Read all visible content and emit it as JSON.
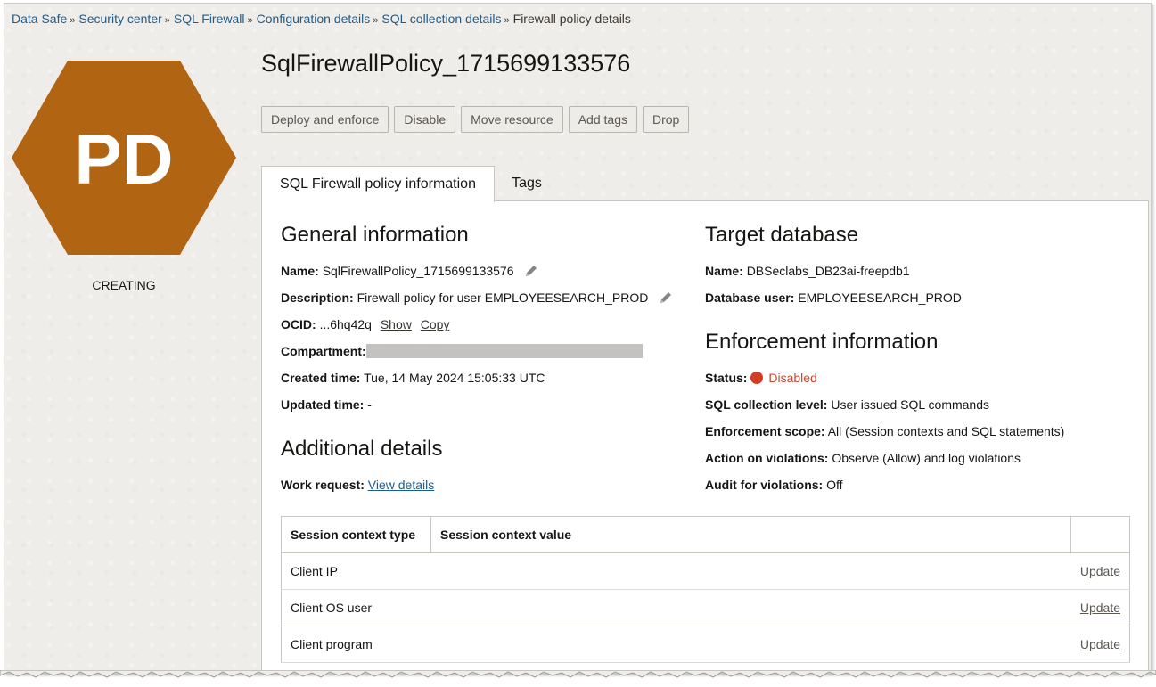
{
  "breadcrumb": {
    "items": [
      "Data Safe",
      "Security center",
      "SQL Firewall",
      "Configuration details",
      "SQL collection details"
    ],
    "separator": "»",
    "current": "Firewall policy details"
  },
  "badge": {
    "initials": "PD",
    "color": "#b16412",
    "status": "CREATING"
  },
  "title": "SqlFirewallPolicy_1715699133576",
  "actions": {
    "deploy": "Deploy and enforce",
    "disable": "Disable",
    "move": "Move resource",
    "add_tags": "Add tags",
    "drop": "Drop"
  },
  "tabs": {
    "info": "SQL Firewall policy information",
    "tags": "Tags"
  },
  "general": {
    "heading": "General information",
    "name_label": "Name:",
    "name_value": "SqlFirewallPolicy_1715699133576",
    "description_label": "Description:",
    "description_value": "Firewall policy for user EMPLOYEESEARCH_PROD",
    "ocid_label": "OCID:",
    "ocid_value": "...6hq42q",
    "ocid_show": "Show",
    "ocid_copy": "Copy",
    "compartment_label": "Compartment:",
    "created_label": "Created time:",
    "created_value": "Tue, 14 May 2024 15:05:33 UTC",
    "updated_label": "Updated time:",
    "updated_value": "-"
  },
  "additional": {
    "heading": "Additional details",
    "work_request_label": "Work request:",
    "work_request_link": "View details"
  },
  "target": {
    "heading": "Target database",
    "name_label": "Name:",
    "name_value": "DBSeclabs_DB23ai-freepdb1",
    "user_label": "Database user:",
    "user_value": "EMPLOYEESEARCH_PROD"
  },
  "enforcement": {
    "heading": "Enforcement information",
    "status_label": "Status:",
    "status_value": "Disabled",
    "status_color": "#d63b25",
    "level_label": "SQL collection level:",
    "level_value": "User issued SQL commands",
    "scope_label": "Enforcement scope:",
    "scope_value": "All (Session contexts and SQL statements)",
    "action_label": "Action on violations:",
    "action_value": "Observe (Allow) and log violations",
    "audit_label": "Audit for violations:",
    "audit_value": "Off"
  },
  "session_table": {
    "headers": [
      "Session context type",
      "Session context value",
      ""
    ],
    "rows": [
      {
        "type": "Client IP",
        "value": "",
        "action": "Update"
      },
      {
        "type": "Client OS user",
        "value": "",
        "action": "Update"
      },
      {
        "type": "Client program",
        "value": "",
        "action": "Update"
      }
    ]
  }
}
